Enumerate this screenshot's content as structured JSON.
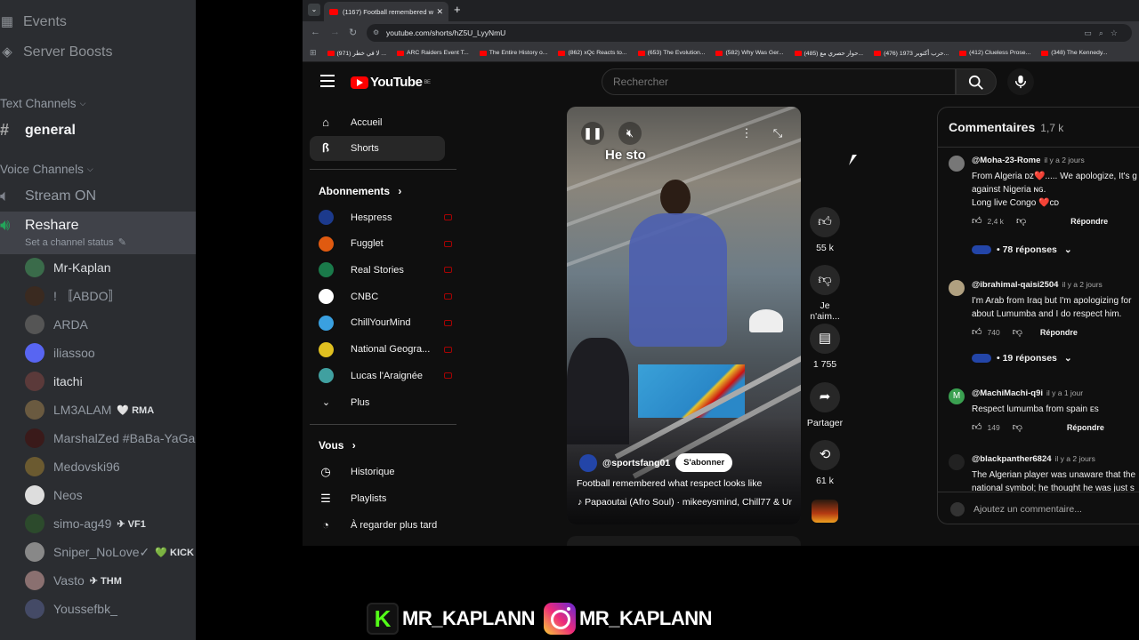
{
  "discord": {
    "top_items": [
      {
        "label": "Events",
        "icon": "calendar-icon"
      },
      {
        "label": "Server Boosts",
        "icon": "boost-icon"
      }
    ],
    "text_category": "Text Channels",
    "text_channels": [
      {
        "label": "general"
      }
    ],
    "voice_category": "Voice Channels",
    "voice_channels": [
      {
        "label": "Stream ON"
      },
      {
        "label": "Reshare",
        "status": "Set a channel status"
      }
    ],
    "members": [
      {
        "name": "Mr-Kaplan",
        "color": "#dbdee1",
        "avatar": "#3a6b4a"
      },
      {
        "name": "! 〚ABDO〛",
        "color": "#949ba4",
        "avatar": "#3a2a20"
      },
      {
        "name": "ARDA",
        "color": "#949ba4",
        "avatar": "#555555"
      },
      {
        "name": "iliassoo",
        "color": "#949ba4",
        "avatar": "#5865f2"
      },
      {
        "name": "itachi",
        "color": "#dbdee1",
        "avatar": "#5b3a3a"
      },
      {
        "name": "LM3ALAM",
        "color": "#949ba4",
        "avatar": "#6a5a40",
        "tag": "🤍 RMA"
      },
      {
        "name": "MarshalZed #BaBa-YaGa",
        "color": "#949ba4",
        "avatar": "#3a1a1a"
      },
      {
        "name": "Medovski96",
        "color": "#949ba4",
        "avatar": "#6b5a30"
      },
      {
        "name": "Neos",
        "color": "#949ba4",
        "avatar": "#dddddd"
      },
      {
        "name": "simo-ag49",
        "color": "#949ba4",
        "avatar": "#2c4a2c",
        "tag": "✈ VF1"
      },
      {
        "name": "Sniper_NoLove✓",
        "color": "#949ba4",
        "avatar": "#888888",
        "tag": "💚 KICK"
      },
      {
        "name": "Vasto",
        "color": "#949ba4",
        "avatar": "#8a7070",
        "tag": "✈ THM"
      },
      {
        "name": "Youssefbk_",
        "color": "#949ba4",
        "avatar": "#444a66"
      }
    ]
  },
  "browser": {
    "tab_title": "(1167) Football remembered w",
    "url": "youtube.com/shorts/hZ5U_LyyNmU",
    "bookmarks": [
      "(971) لا في خطر ...",
      "ARC Raiders Event T...",
      "The Entire History o...",
      "(862) xQc Reacts to...",
      "(653) The Evolution...",
      "(582) Why Was Ger...",
      "(485) حوار حصري مع...",
      "(476) حرب أكتوبر 1973...",
      "(412) Clueless Prose...",
      "(348) The Kennedy..."
    ]
  },
  "youtube": {
    "logo": "YouTube",
    "region": "BE",
    "search_placeholder": "Rechercher",
    "nav": {
      "home": "Accueil",
      "shorts": "Shorts",
      "subscriptions_header": "Abonnements",
      "subscriptions": [
        {
          "name": "Hespress",
          "avatar": "#1c3a8c"
        },
        {
          "name": "Fugglet",
          "avatar": "#e05a10"
        },
        {
          "name": "Real Stories",
          "avatar": "#1a7a4a"
        },
        {
          "name": "CNBC",
          "avatar": "#ffffff"
        },
        {
          "name": "ChillYourMind",
          "avatar": "#3aa0e0"
        },
        {
          "name": "National Geogra...",
          "avatar": "#e0c020"
        },
        {
          "name": "Lucas l'Araignée",
          "avatar": "#40a0a0"
        }
      ],
      "more": "Plus",
      "you_header": "Vous",
      "you_items": [
        "Historique",
        "Playlists",
        "À regarder plus tard"
      ]
    },
    "short": {
      "overlay_caption": "He sto",
      "channel": "@sportsfang01",
      "subscribe": "S'abonner",
      "title": "Football remembered what respect looks like",
      "music": "Papaoutai (Afro Soul) · mikeeysmind, Chill77 & Ur"
    },
    "actions": {
      "likes": "55 k",
      "dislike": "Je n'aim...",
      "comments": "1 755",
      "share": "Partager",
      "remix": "61 k"
    },
    "comments": {
      "title": "Commentaires",
      "count": "1,7 k",
      "items": [
        {
          "author": "@Moha-23-Rome",
          "age": "il y a 2 jours",
          "text": "From Algeria ᴅᴢ❤️..... We apologize, It's g\nagainst Nigeria ɴɢ.\nLong live Congo ❤️ᴄᴅ",
          "likes": "2,4 k",
          "reply": "Répondre",
          "replies": "• 78 réponses",
          "avatar": "#777777"
        },
        {
          "author": "@ibrahimal-qaisi2504",
          "age": "il y a 2 jours",
          "text": "I'm Arab from Iraq but I'm apologizing for\nabout Lumumba and I do respect him.",
          "likes": "740",
          "reply": "Répondre",
          "replies": "• 19 réponses",
          "avatar": "#b0a080"
        },
        {
          "author": "@MachiMachi-q9i",
          "age": "il y a 1 jour",
          "text": "Respect lumumba from spain ᴇs",
          "likes": "149",
          "reply": "Répondre",
          "avatar": "#3aa050",
          "initial": "M"
        },
        {
          "author": "@blackpanther6824",
          "age": "il y a 2 jours",
          "text": "The Algerian player was unaware that the\nnational symbol; he thought he was just s",
          "avatar": "#222222"
        }
      ],
      "add_placeholder": "Ajoutez un commentaire..."
    }
  },
  "overlay": {
    "kick_handle": "MR_KAPLANN",
    "instagram_handle": "MR_KAPLANN"
  }
}
